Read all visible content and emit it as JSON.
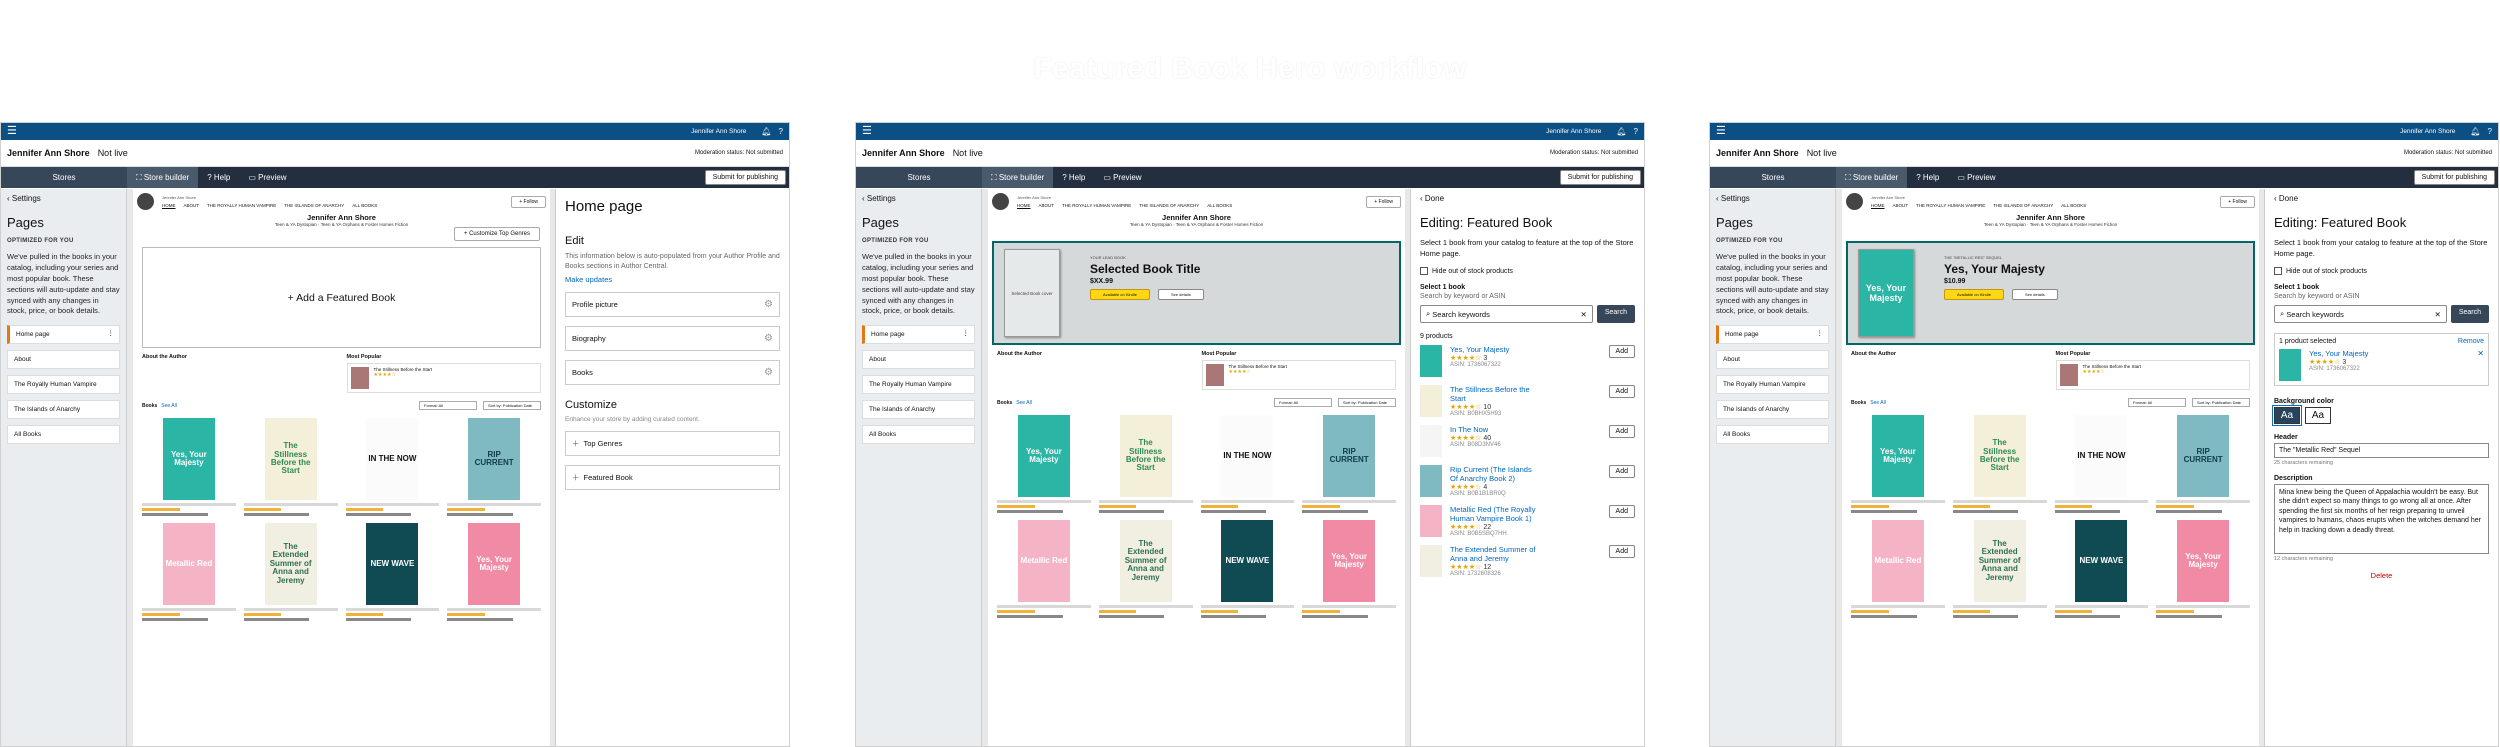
{
  "title": "Featured Book Hero workflow",
  "app": {
    "author_menu": "Jennifer Ann Shore",
    "store_name": "Jennifer Ann Shore",
    "live_status": "Not live",
    "moderation": "Moderation status: Not submitted",
    "stores": "Stores",
    "tabs": [
      "Store builder",
      "Help",
      "Preview"
    ],
    "submit": "Submit for publishing"
  },
  "left": {
    "settings": "Settings",
    "pages_heading": "Pages",
    "optimized": "OPTIMIZED FOR YOU",
    "optimized_text": "We've pulled in the books in your catalog, including your series and most popular book. These sections will auto-update and stay synced with any changes in stock, price, or book details.",
    "pages": [
      "Home page",
      "About",
      "The Royally Human Vampire",
      "The Islands of Anarchy",
      "All Books"
    ]
  },
  "storefront": {
    "nav": [
      "HOME",
      "ABOUT",
      "THE ROYALLY HUMAN VAMPIRE",
      "THE ISLANDS OF ANARCHY",
      "ALL BOOKS"
    ],
    "follow": "+ Follow",
    "genres": "Teen & YA Dystopian · Teen & YA Orphans & Foster Homes Fiction",
    "customize_genres": "+ Customize Top Genres",
    "add_featured": "+ Add a Featured Book",
    "about_heading": "About the Author",
    "popular_heading": "Most Popular",
    "popular_title": "The Stillness Before the Start",
    "books_label": "Books",
    "see_all": "See All",
    "format": "Format: All",
    "sort": "Sort by: Publication Date",
    "placeholder_label": "YOUR LEAD BOOK",
    "placeholder_title": "Selected Book Title",
    "placeholder_cover": "Selected Book cover",
    "placeholder_price": "$XX.99",
    "hero_title": "Yes, Your Majesty",
    "hero_label": "THE \"METALLIC RED\" SEQUEL",
    "hero_price": "$10.99",
    "btn_buy": "Available on Kindle",
    "btn_details": "See details",
    "books": [
      {
        "title": "Yes, Your Majesty",
        "bg": "#2bb5a4",
        "fg": "#fff"
      },
      {
        "title": "The Stillness Before the Start",
        "bg": "#f4efd8",
        "fg": "#2c8b55"
      },
      {
        "title": "IN THE NOW",
        "bg": "#fbfbfb",
        "fg": "#111"
      },
      {
        "title": "RIP CURRENT",
        "bg": "#7fb9c1",
        "fg": "#0f3d4a"
      },
      {
        "title": "Metallic Red",
        "bg": "#f5b4c6",
        "fg": "#fff"
      },
      {
        "title": "The Extended Summer of Anna and Jeremy",
        "bg": "#f1eee2",
        "fg": "#2f6f53"
      },
      {
        "title": "NEW WAVE",
        "bg": "#104a52",
        "fg": "#fff"
      },
      {
        "title": "Yes, Your Majesty",
        "bg": "#f08aa5",
        "fg": "#fff"
      }
    ]
  },
  "home_edit": {
    "heading": "Home page",
    "edit": "Edit",
    "edit_text": "This information below is auto-populated from your Author Profile and Books sections in Author Central.",
    "make_updates": "Make updates",
    "items": [
      "Profile picture",
      "Biography",
      "Books"
    ],
    "customize": "Customize",
    "customize_text": "Enhance your store by adding curated content.",
    "custom_items": [
      "Top Genres",
      "Featured Book"
    ]
  },
  "editor": {
    "done": "Done",
    "heading": "Editing: Featured Book",
    "intro": "Select 1 book from your catalog to feature at the top of the Store Home page.",
    "hide_stock": "Hide out of stock products",
    "select_label": "Select 1 book",
    "search_by": "Search by keyword or ASIN",
    "search_placeholder": "Search keywords",
    "search_btn": "Search",
    "count": "9 products",
    "add": "Add",
    "products": [
      {
        "title": "Yes, Your Majesty",
        "reviews": "3",
        "asin": "ASIN: 1736067322",
        "color": "#2bb5a4"
      },
      {
        "title": "The Stillness Before the Start",
        "reviews": "10",
        "asin": "ASIN: B0BHX5H93",
        "color": "#f4efd8"
      },
      {
        "title": "In The Now",
        "reviews": "40",
        "asin": "ASIN: B08D3NV46",
        "color": "#f5f5f5"
      },
      {
        "title": "Rip Current (The Islands Of Anarchy Book 2)",
        "reviews": "4",
        "asin": "ASIN: B0B1B1BR0Q",
        "color": "#7fb9c1"
      },
      {
        "title": "Metallic Red (The Royally Human Vampire Book 1)",
        "reviews": "22",
        "asin": "ASIN: B0B5SBQ7HH",
        "color": "#f5b4c6"
      },
      {
        "title": "The Extended Summer of Anna and Jeremy",
        "reviews": "12",
        "asin": "ASIN: 1732608326",
        "color": "#f1eee2"
      }
    ],
    "selected": "1 product selected",
    "remove": "Remove",
    "bg_color": "Background color",
    "swatch": "Aa",
    "header_label": "Header",
    "header_value": "The \"Metallic Red\" Sequel",
    "header_count": "25 characters remaining",
    "desc_label": "Description",
    "desc_value": "Mina knew being the Queen of Appalachia wouldn't be easy. But she didn't expect so many things to go wrong all at once. After spending the first six months of her reign preparing to unveil vampires to humans, chaos erupts when the witches demand her help in tracking down a deadly threat.",
    "desc_count": "12 characters remaining",
    "delete": "Delete"
  }
}
